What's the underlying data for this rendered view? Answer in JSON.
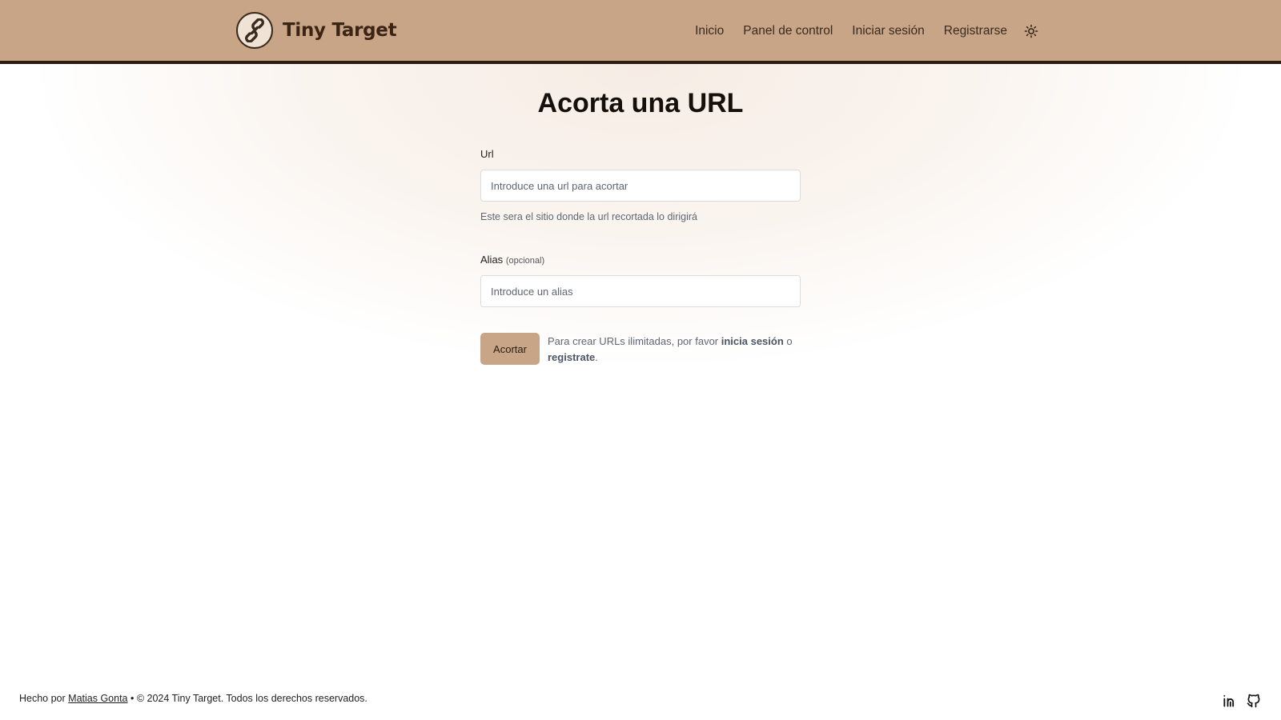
{
  "header": {
    "brand": "Tiny Target",
    "nav": [
      "Inicio",
      "Panel de control",
      "Iniciar sesión",
      "Registrarse"
    ],
    "theme_icon": "sun-icon"
  },
  "main": {
    "title": "Acorta una URL",
    "url_field": {
      "label": "Url",
      "placeholder": "Introduce una url para acortar",
      "value": "",
      "hint": "Este sera el sitio donde la url recortada lo dirigirá"
    },
    "alias_field": {
      "label": "Alias",
      "optional": "(opcional)",
      "placeholder": "Introduce un alias",
      "value": ""
    },
    "submit_label": "Acortar",
    "note": {
      "before": "Para crear URLs ilimitadas, por favor ",
      "login_link": "inicia sesión",
      "middle": " o ",
      "register_link": "registrate",
      "after": "."
    }
  },
  "footer": {
    "prefix": "Hecho por ",
    "author": "Matias Gonta",
    "suffix": " • © 2024 Tiny Target. Todos los derechos reservados.",
    "icons": [
      "linkedin-icon",
      "github-icon"
    ]
  },
  "colors": {
    "header_bg": "#c8a587",
    "header_border": "#2b1d12",
    "button_bg": "#c8a587"
  }
}
